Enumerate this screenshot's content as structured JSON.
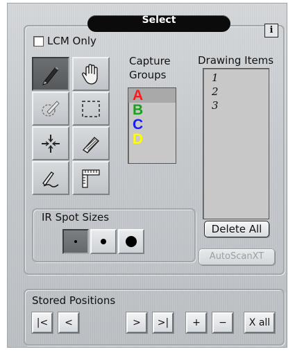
{
  "title": "Select",
  "info_button": "i",
  "lcm_only": {
    "label": "LCM Only",
    "checked": false
  },
  "tools": [
    {
      "name": "pen-tool",
      "active": true
    },
    {
      "name": "hand-tool",
      "active": false
    },
    {
      "name": "lasso-tool",
      "active": false
    },
    {
      "name": "rect-select-tool",
      "active": false
    },
    {
      "name": "crosshair-tool",
      "active": false
    },
    {
      "name": "eraser-tool",
      "active": false
    },
    {
      "name": "freehand-tool",
      "active": false
    },
    {
      "name": "ruler-tool",
      "active": false
    }
  ],
  "capture_groups": {
    "label_line1": "Capture",
    "label_line2": "Groups",
    "items": [
      {
        "label": "A",
        "color": "#ff1a1a",
        "selected": true
      },
      {
        "label": "B",
        "color": "#1aa01a",
        "selected": false
      },
      {
        "label": "C",
        "color": "#1a1aff",
        "selected": false
      },
      {
        "label": "D",
        "color": "#ffff00",
        "selected": false
      }
    ]
  },
  "drawing_items": {
    "label": "Drawing Items",
    "items": [
      "1",
      "2",
      "3"
    ]
  },
  "delete_all": "Delete All",
  "autoscan": {
    "label": "AutoScanXT",
    "enabled": false
  },
  "ir_spot_sizes": {
    "label": "IR Spot Sizes",
    "sizes": [
      "small",
      "medium",
      "large"
    ],
    "selected": "small"
  },
  "stored_positions": {
    "label": "Stored Positions",
    "buttons": {
      "first": "|<",
      "prev": "<",
      "next": ">",
      "last": ">|",
      "add": "+",
      "remove": "−",
      "clear_all": "X all"
    }
  }
}
